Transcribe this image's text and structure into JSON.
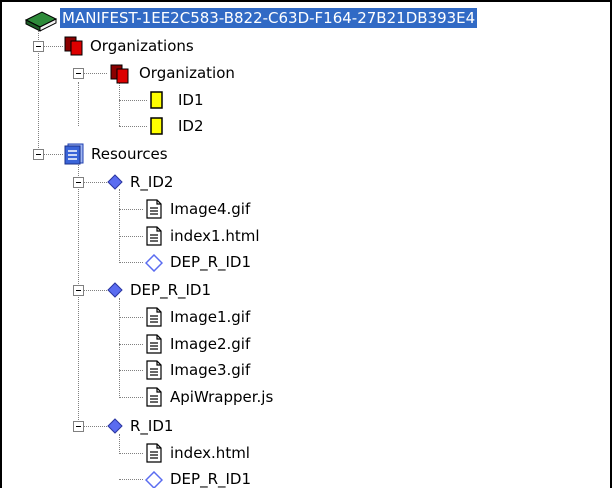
{
  "tree": {
    "root": {
      "label": "MANIFEST-1EE2C583-B822-C63D-F164-27B21DB393E4",
      "icon": "book-icon",
      "selected": true
    },
    "organizations": {
      "label": "Organizations",
      "icon": "organizations-icon",
      "organization": {
        "label": "Organization",
        "icon": "organization-icon",
        "items": [
          {
            "label": "ID1",
            "icon": "item-icon"
          },
          {
            "label": "ID2",
            "icon": "item-icon"
          }
        ]
      }
    },
    "resources": {
      "label": "Resources",
      "icon": "resources-icon",
      "items": [
        {
          "label": "R_ID2",
          "icon": "resource-icon",
          "children": [
            {
              "label": "Image4.gif",
              "icon": "file-icon"
            },
            {
              "label": "index1.html",
              "icon": "file-icon"
            },
            {
              "label": "DEP_R_ID1",
              "icon": "dependency-icon"
            }
          ]
        },
        {
          "label": "DEP_R_ID1",
          "icon": "resource-icon",
          "children": [
            {
              "label": "Image1.gif",
              "icon": "file-icon"
            },
            {
              "label": "Image2.gif",
              "icon": "file-icon"
            },
            {
              "label": "Image3.gif",
              "icon": "file-icon"
            },
            {
              "label": "ApiWrapper.js",
              "icon": "file-icon"
            }
          ]
        },
        {
          "label": "R_ID1",
          "icon": "resource-icon",
          "children": [
            {
              "label": "index.html",
              "icon": "file-icon"
            },
            {
              "label": "DEP_R_ID1",
              "icon": "dependency-icon"
            }
          ]
        }
      ]
    }
  },
  "colors": {
    "selection": "#316ac5",
    "tree_line": "#808080",
    "book_green": "#2e8b3a",
    "organization_red": "#dd0000",
    "item_yellow": "#ffff00",
    "resources_blue": "#3a64d8",
    "resource_diamond": "#5a6cf0"
  }
}
